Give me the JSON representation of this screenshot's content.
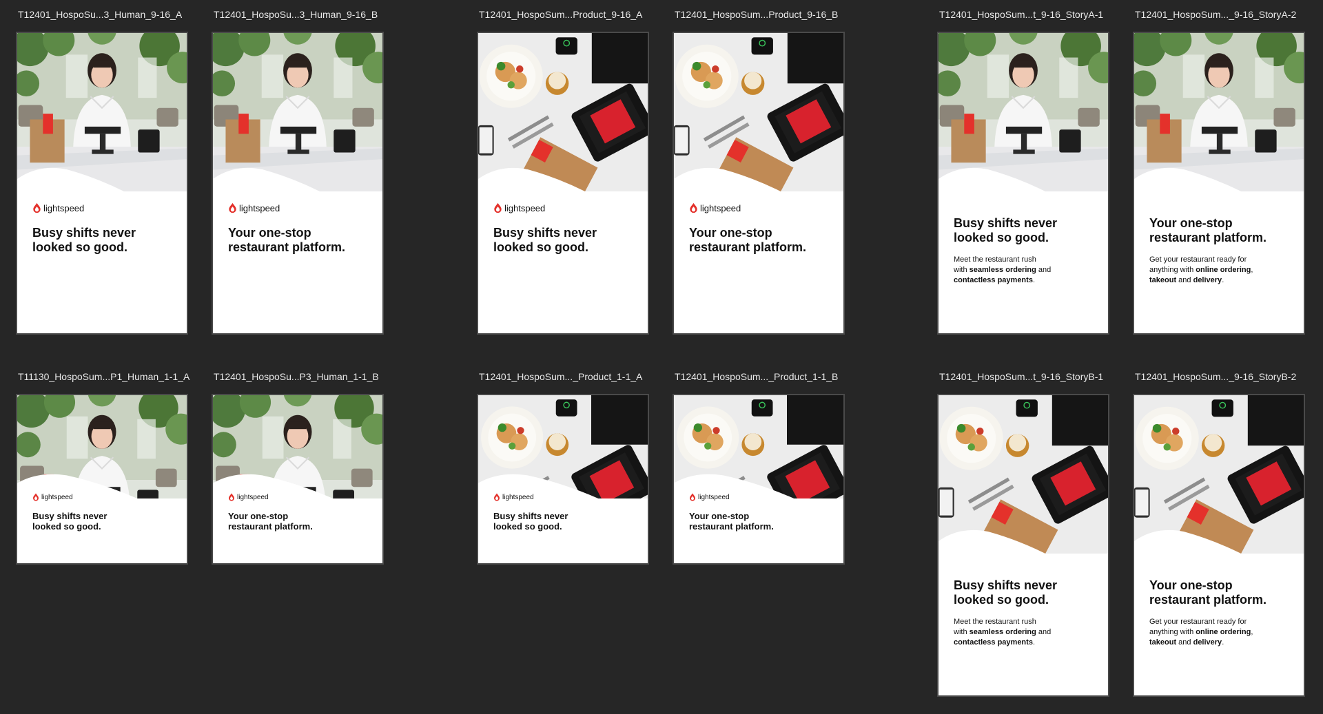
{
  "colors": {
    "canvas": "#262626",
    "brand_red": "#e4312b",
    "artboard_border": "#4a4a4a"
  },
  "brand": {
    "name": "lightspeed",
    "icon": "flame-logo-icon"
  },
  "copy": {
    "headline_a_line1": "Busy shifts never",
    "headline_a_line2": "looked so good.",
    "headline_b_line1": "Your one-stop",
    "headline_b_line2": "restaurant platform.",
    "body_a": {
      "l1": "Meet the restaurant rush",
      "l2a": "with ",
      "l2b": "seamless ordering",
      "l2c": " and",
      "l3a": "contactless payments",
      "l3b": "."
    },
    "body_b": {
      "l1": "Get your restaurant ready for",
      "l2a": "anything with ",
      "l2b": "online ordering",
      "l2c": ",",
      "l3a": "takeout",
      "l3b": " and ",
      "l3c": "delivery",
      "l3d": "."
    }
  },
  "artboards": [
    {
      "title": "T12401_HospoSu...3_Human_9-16_A"
    },
    {
      "title": "T12401_HospoSu...3_Human_9-16_B"
    },
    {
      "title": "T12401_HospoSum...Product_9-16_A"
    },
    {
      "title": "T12401_HospoSum...Product_9-16_B"
    },
    {
      "title": "T12401_HospoSum...t_9-16_StoryA-1"
    },
    {
      "title": "T12401_HospoSum..._9-16_StoryA-2"
    },
    {
      "title": "T11130_HospoSum...P1_Human_1-1_A"
    },
    {
      "title": "T12401_HospoSu...P3_Human_1-1_B"
    },
    {
      "title": "T12401_HospoSum..._Product_1-1_A"
    },
    {
      "title": "T12401_HospoSum..._Product_1-1_B"
    },
    {
      "title": "T12401_HospoSum...t_9-16_StoryB-1"
    },
    {
      "title": "T12401_HospoSum..._9-16_StoryB-2"
    }
  ]
}
